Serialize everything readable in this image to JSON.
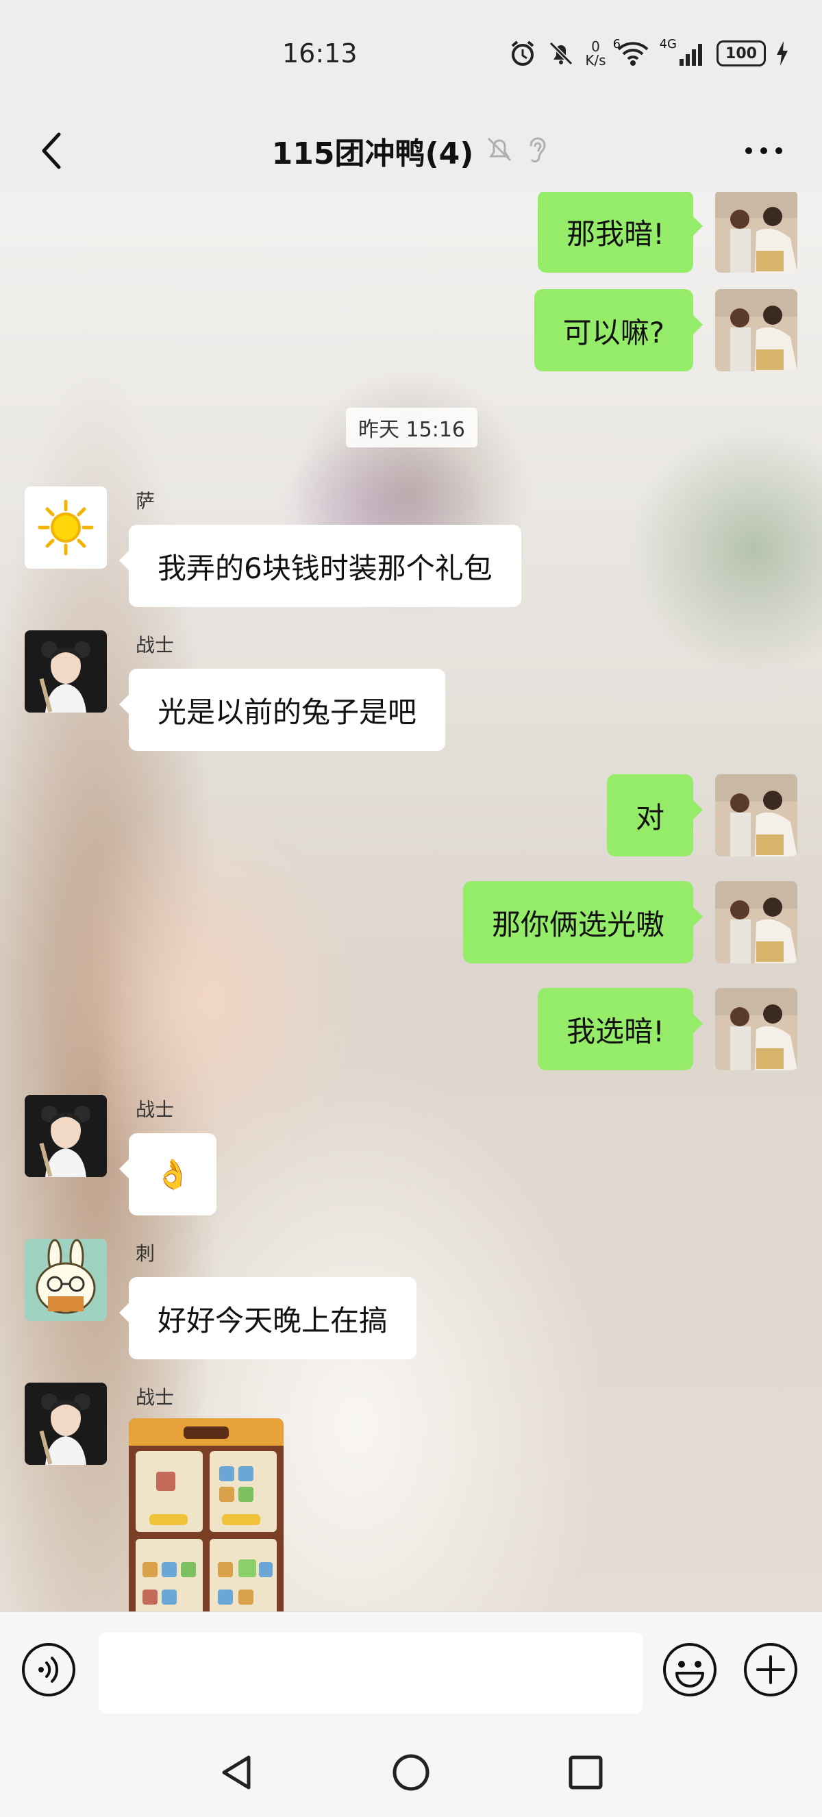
{
  "status_bar": {
    "time": "16:13",
    "net_speed_value": "0",
    "net_speed_unit": "K/s",
    "signal_label": "4G",
    "wifi_label": "6",
    "battery": "100",
    "icons": [
      "alarm-icon",
      "mute-icon",
      "wifi-icon",
      "signal-icon",
      "battery-icon",
      "charging-icon"
    ]
  },
  "header": {
    "title": "115团冲鸭(4)",
    "icons": [
      "back-icon",
      "mute-bell-icon",
      "ear-icon",
      "more-icon"
    ]
  },
  "chat": {
    "timestamp": "昨天 15:16",
    "messages": [
      {
        "side": "right",
        "text": "那我暗!"
      },
      {
        "side": "right",
        "text": "可以嘛?"
      },
      {
        "side": "left",
        "sender": "萨",
        "text": "我弄的6块钱时装那个礼包"
      },
      {
        "side": "left",
        "sender": "战士",
        "text": "光是以前的兔子是吧"
      },
      {
        "side": "right",
        "text": "对"
      },
      {
        "side": "right",
        "text": "那你俩选光嗷"
      },
      {
        "side": "right",
        "text": "我选暗!"
      },
      {
        "side": "left",
        "sender": "战士",
        "text": "👌"
      },
      {
        "side": "left",
        "sender": "刺",
        "text": "好好今天晚上在搞"
      },
      {
        "side": "left",
        "sender": "战士",
        "type": "image"
      }
    ]
  },
  "input_bar": {
    "placeholder": "",
    "icons": [
      "voice-icon",
      "emoji-icon",
      "plus-icon"
    ]
  },
  "nav_bar": {
    "icons": [
      "back-triangle-icon",
      "home-circle-icon",
      "recents-square-icon"
    ]
  },
  "colors": {
    "bubble_green": "#95ec69",
    "bubble_white": "#ffffff",
    "bar_bg": "#ededed"
  }
}
